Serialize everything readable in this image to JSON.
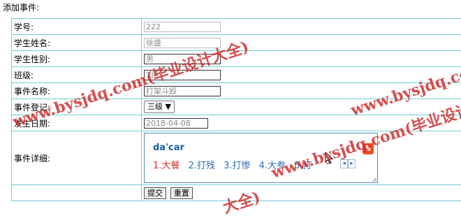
{
  "page": {
    "title": "添加事件:"
  },
  "form": {
    "student_id": {
      "label": "学号:",
      "value": "222"
    },
    "student_name": {
      "label": "学生姓名:",
      "value": "徐盛"
    },
    "student_gender": {
      "label": "学生性别:",
      "value": "男"
    },
    "class": {
      "label": "班级:",
      "value": "1班"
    },
    "event_name": {
      "label": "事件名称:",
      "value": "打架斗殴"
    },
    "event_level": {
      "label": "事件登记:",
      "selected": "三级 ▼"
    },
    "date": {
      "label": "发生日期:",
      "value": "2018-04-08"
    },
    "detail": {
      "label": "事件详细:"
    },
    "buttons": {
      "submit": "提交",
      "reset": "重置"
    }
  },
  "ime": {
    "composition": "da'car",
    "logo": "S",
    "candidates": [
      "1.大餐",
      "2.打残",
      "3.打惨",
      "4.大参",
      "5.打"
    ],
    "prev": "◂",
    "next": "▸"
  },
  "watermarks": [
    "www.bysjdq.com(毕业设计大全)",
    "www.bysjdq.com(毕业设计",
    "www.bysjdq.com(毕业设计大全)",
    "大全)"
  ]
}
